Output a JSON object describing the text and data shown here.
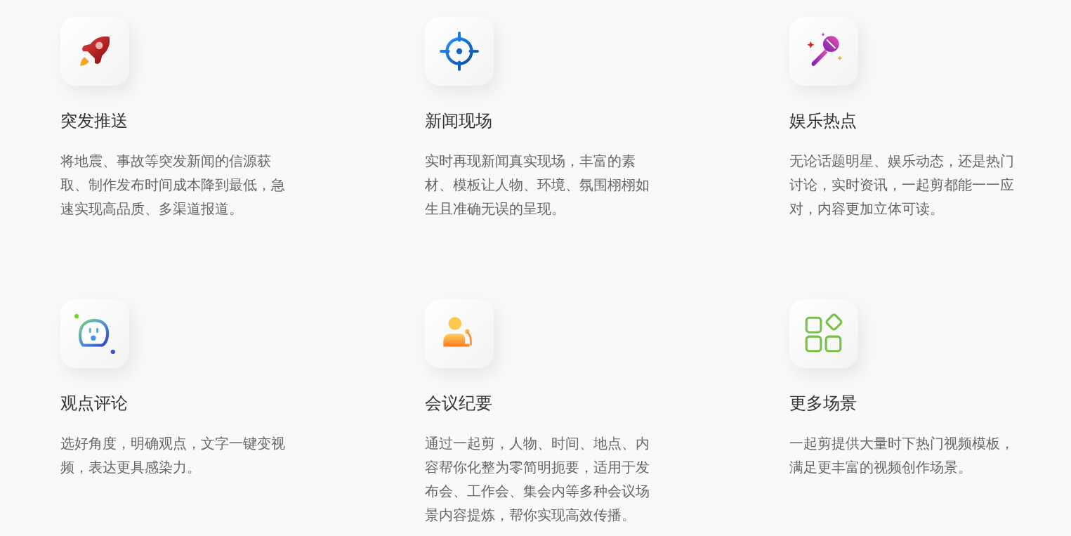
{
  "features": [
    {
      "title": "突发推送",
      "description": "将地震、事故等突发新闻的信源获取、制作发布时间成本降到最低，急速实现高品质、多渠道报道。"
    },
    {
      "title": "新闻现场",
      "description": "实时再现新闻真实现场，丰富的素材、模板让人物、环境、氛围栩栩如生且准确无误的呈现。"
    },
    {
      "title": "娱乐热点",
      "description": "无论话题明星、娱乐动态，还是热门讨论，实时资讯，一起剪都能一一应对，内容更加立体可读。"
    },
    {
      "title": "观点评论",
      "description": "选好角度，明确观点，文字一键变视频，表达更具感染力。"
    },
    {
      "title": "会议纪要",
      "description": "通过一起剪，人物、时间、地点、内容帮你化整为零简明扼要，适用于发布会、工作会、集会内等多种会议场景内容提炼，帮你实现高效传播。"
    },
    {
      "title": "更多场景",
      "description": "一起剪提供大量时下热门视频模板，满足更丰富的视频创作场景。"
    }
  ]
}
